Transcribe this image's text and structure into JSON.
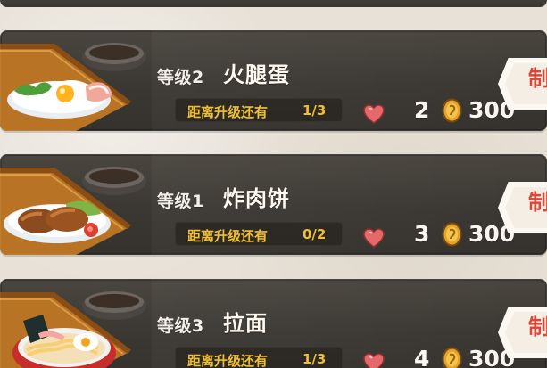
{
  "cards": [
    {
      "level": "等级2",
      "dish": "火腿蛋",
      "upgrade_label": "距离升级还有",
      "upgrade_progress": "1/3",
      "heart_count": "2",
      "coin_count": "300",
      "make_label": "制",
      "food_icon": "ham-egg-icon"
    },
    {
      "level": "等级1",
      "dish": "炸肉饼",
      "upgrade_label": "距离升级还有",
      "upgrade_progress": "0/2",
      "heart_count": "3",
      "coin_count": "300",
      "make_label": "制",
      "food_icon": "cutlet-icon"
    },
    {
      "level": "等级3",
      "dish": "拉面",
      "upgrade_label": "距离升级还有",
      "upgrade_progress": "1/3",
      "heart_count": "4",
      "coin_count": "300",
      "make_label": "制",
      "food_icon": "ramen-icon"
    }
  ],
  "colors": {
    "card_background": "#3d3a35",
    "upgrade_text": "#efbf34",
    "heart": "#e5696a",
    "coin": "#d89b24",
    "make_button_text": "#d94738"
  }
}
